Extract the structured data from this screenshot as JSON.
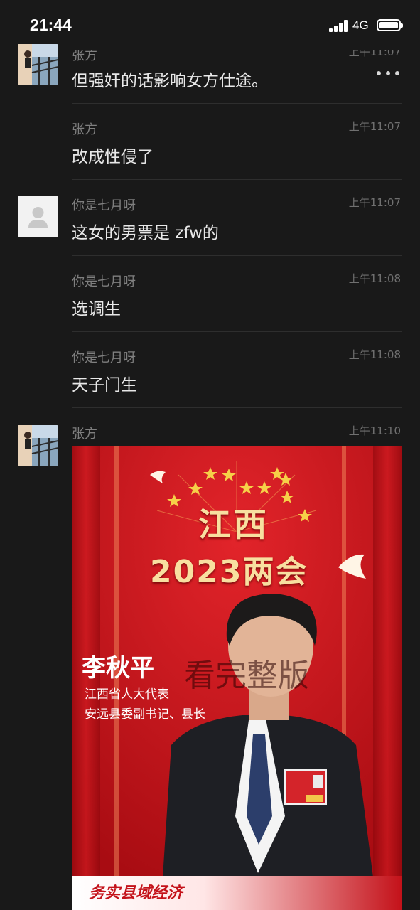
{
  "status_bar": {
    "time": "21:44",
    "network": "4G"
  },
  "messages": [
    {
      "sender": "张方",
      "time": "上午11:07",
      "text": "但强奸的话影响女方仕途。",
      "avatar": "photo"
    },
    {
      "sender": "张方",
      "time": "上午11:07",
      "text": "改成性侵了"
    },
    {
      "sender": "你是七月呀",
      "time": "上午11:07",
      "text": "这女的男票是 zfw的",
      "avatar": "default"
    },
    {
      "sender": "你是七月呀",
      "time": "上午11:08",
      "text": "选调生"
    },
    {
      "sender": "你是七月呀",
      "time": "上午11:08",
      "text": "天子门生"
    },
    {
      "sender": "张方",
      "time": "上午11:10",
      "avatar": "photo"
    }
  ],
  "poster": {
    "title_line1": "江西",
    "title_line2": "2023两会",
    "name": "李秋平",
    "role_line1": "江西省人大代表",
    "role_line2": "安远县委副书记、县长",
    "bottom_banner": "务实县域经济",
    "watermark": "看完整版"
  },
  "colors": {
    "background": "#191919",
    "poster_red": "#c4121a",
    "gold": "#f4d06a"
  }
}
